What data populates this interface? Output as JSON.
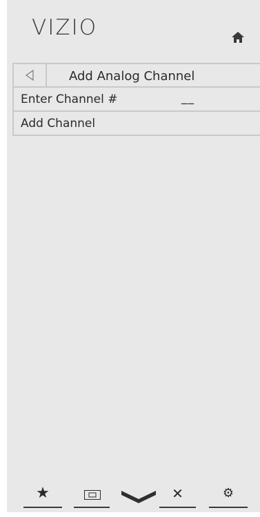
{
  "app": {
    "logo": "VIZIO"
  },
  "header": {
    "title": "Add Analog Channel"
  },
  "rows": [
    {
      "label": "Enter Channel #",
      "value": "__"
    },
    {
      "label": "Add Channel",
      "value": ""
    }
  ],
  "bottom_nav": [
    {
      "icon": "star-icon",
      "glyph": "★"
    },
    {
      "icon": "screen-icon",
      "glyph": ""
    },
    {
      "icon": "vizio-v-icon",
      "glyph": ""
    },
    {
      "icon": "close-icon",
      "glyph": "✕"
    },
    {
      "icon": "gear-icon",
      "glyph": "⚙"
    }
  ],
  "colors": {
    "panel_bg": "#e8e8e8",
    "divider": "#c9c9c9",
    "text": "#2a2a2a"
  }
}
